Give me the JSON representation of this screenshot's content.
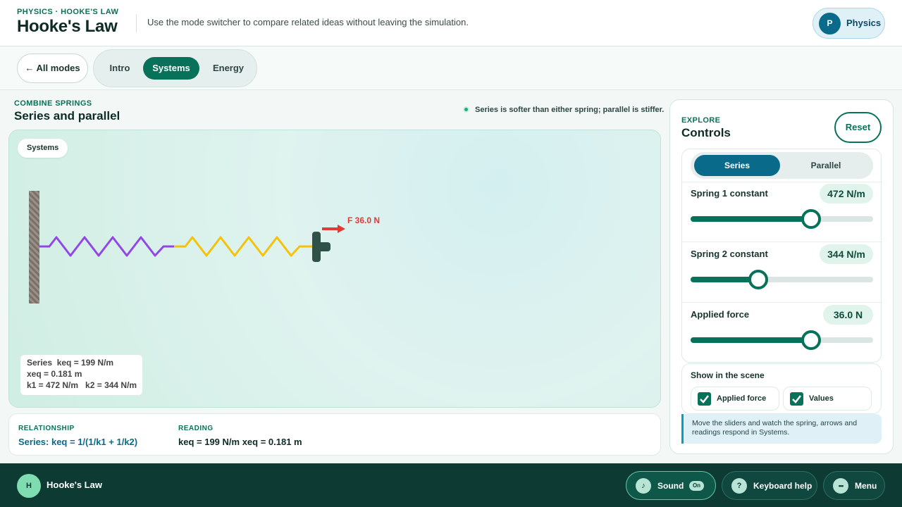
{
  "header": {
    "eyebrow": "PHYSICS · HOOKE'S LAW",
    "title": "Hooke's Law",
    "subtitle": "Use the mode switcher to compare related ideas without leaving the simulation.",
    "subject_initial": "P",
    "subject_label": "Physics"
  },
  "modebar": {
    "back_label": "← All modes",
    "tabs": [
      {
        "label": "Intro",
        "active": false
      },
      {
        "label": "Systems",
        "active": true
      },
      {
        "label": "Energy",
        "active": false
      }
    ]
  },
  "section": {
    "eyebrow": "COMBINE SPRINGS",
    "title": "Series and parallel",
    "hint": "Series is softer than either spring; parallel is stiffer."
  },
  "scene": {
    "tag": "Systems",
    "force_label": "F 36.0 N",
    "spring1_color": "#9146e8",
    "spring2_color": "#f4c20d",
    "force_color": "#e53935",
    "readout": {
      "line1": "Series  keq = 199 N/m",
      "line2": "xeq = 0.181 m",
      "line3": "k1 = 472 N/m   k2 = 344 N/m"
    }
  },
  "relationship": {
    "label": "RELATIONSHIP",
    "value": "Series: keq = 1/(1/k1 + 1/k2)",
    "reading_label": "READING",
    "reading_value": "keq = 199 N/m xeq = 0.181 m"
  },
  "controls": {
    "eyebrow": "EXPLORE",
    "title": "Controls",
    "reset_label": "Reset",
    "segment": [
      {
        "label": "Series",
        "active": true
      },
      {
        "label": "Parallel",
        "active": false
      }
    ],
    "sliders": [
      {
        "label": "Spring 1 constant",
        "value": "472 N/m",
        "fraction": 0.66
      },
      {
        "label": "Spring 2 constant",
        "value": "344 N/m",
        "fraction": 0.37
      },
      {
        "label": "Applied force",
        "value": "36.0 N",
        "fraction": 0.66
      }
    ],
    "show_title": "Show in the scene",
    "checks": [
      {
        "label": "Applied force",
        "checked": true
      },
      {
        "label": "Values",
        "checked": true
      }
    ],
    "note": "Move the sliders and watch the spring, arrows and readings respond in Systems."
  },
  "footer": {
    "avatar": "H",
    "title": "Hooke's Law",
    "sound_label": "Sound",
    "sound_badge": "On",
    "keyboard_label": "Keyboard help",
    "menu_label": "Menu",
    "icons": {
      "sound": "♪",
      "keyboard": "?",
      "menu": "•••"
    }
  },
  "colors": {
    "accent": "#08715a",
    "secondary": "#0a6a8a",
    "footer": "#0d3a32"
  }
}
